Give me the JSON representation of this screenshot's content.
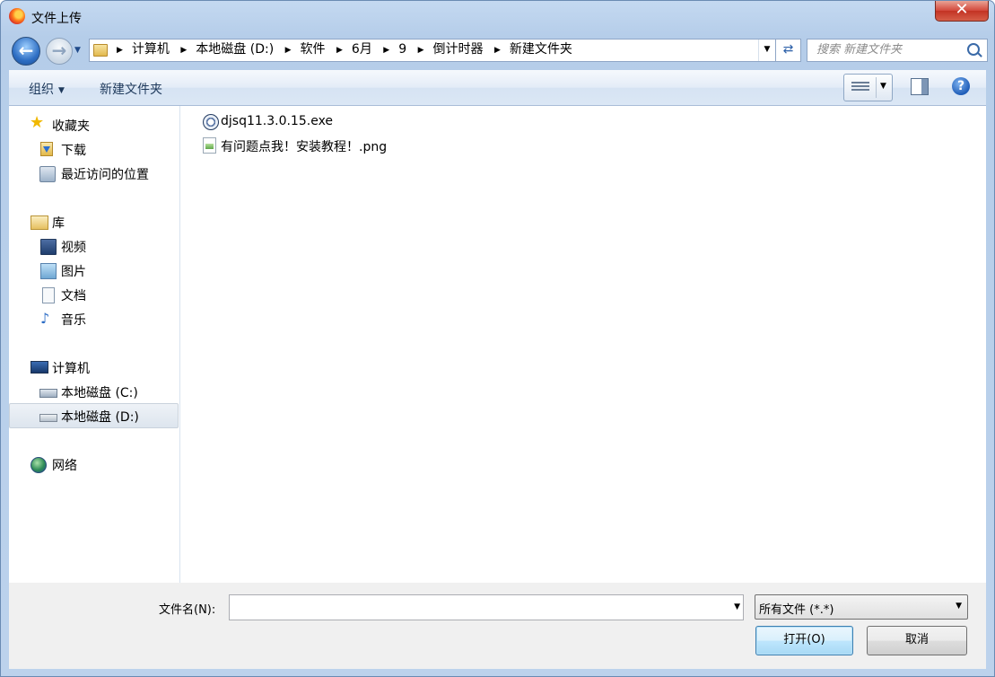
{
  "window": {
    "title": "文件上传",
    "close_label": "✕"
  },
  "navigation": {
    "breadcrumbs": [
      "计算机",
      "本地磁盘 (D:)",
      "软件",
      "6月",
      "9",
      "倒计时器",
      "新建文件夹"
    ],
    "search_placeholder": "搜索 新建文件夹"
  },
  "toolbar": {
    "organize_label": "组织",
    "new_folder_label": "新建文件夹",
    "help_label": "?"
  },
  "sidebar": {
    "favorites": {
      "label": "收藏夹",
      "items": [
        "下载",
        "最近访问的位置"
      ]
    },
    "libraries": {
      "label": "库",
      "items": [
        "视频",
        "图片",
        "文档",
        "音乐"
      ]
    },
    "computer": {
      "label": "计算机",
      "items": [
        "本地磁盘 (C:)",
        "本地磁盘 (D:)"
      ],
      "selected": "本地磁盘 (D:)"
    },
    "network": {
      "label": "网络"
    }
  },
  "files": [
    {
      "name": "djsq11.3.0.15.exe",
      "icon": "exe-icon"
    },
    {
      "name": "有问题点我！安装教程！.png",
      "icon": "png-image-icon"
    }
  ],
  "footer": {
    "filename_label": "文件名(N):",
    "filename_value": "",
    "filetype_value": "所有文件 (*.*)",
    "open_label": "打开(O)",
    "cancel_label": "取消"
  }
}
